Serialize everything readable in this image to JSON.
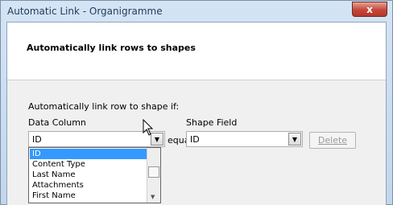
{
  "window": {
    "title": "Automatic Link - Organigramme",
    "close_label": "x"
  },
  "header": {
    "title": "Automatically link rows to shapes"
  },
  "form": {
    "intro": "Automatically link row to shape if:",
    "data_column_label": "Data Column",
    "shape_field_label": "Shape Field",
    "data_column_value": "ID",
    "equals_label": "equals",
    "shape_field_value": "ID",
    "delete_label": "Delete"
  },
  "dropdown": {
    "options": [
      "ID",
      "Content Type",
      "Last Name",
      "Attachments",
      "First Name"
    ],
    "selected_index": 0
  },
  "colors": {
    "selection": "#3399ff",
    "close_button": "#c3483a"
  }
}
